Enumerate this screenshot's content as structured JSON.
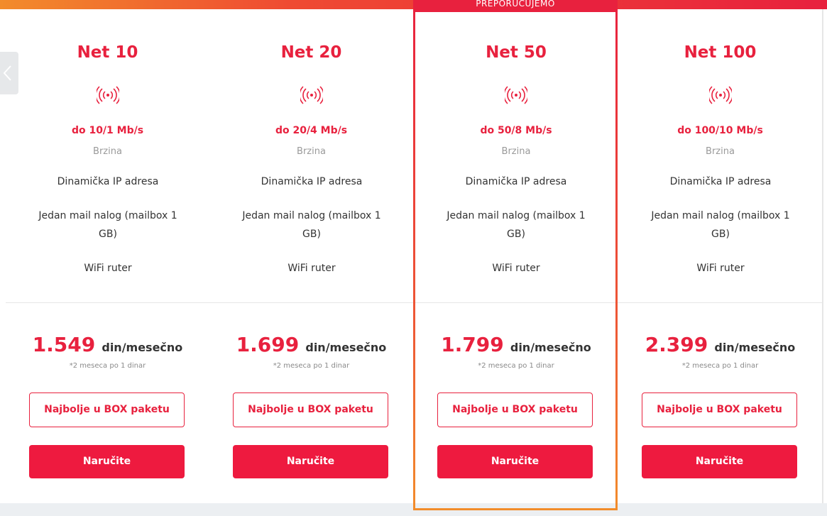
{
  "ribbon": {
    "label": "PREPORUČUJEMO"
  },
  "plans": [
    {
      "name": "Net 10",
      "speed": "do 10/1 Mb/s",
      "speed_label": "Brzina",
      "features": [
        "Dinamička IP adresa",
        "Jedan mail nalog (mailbox 1 GB)",
        "WiFi ruter"
      ],
      "price": "1.549",
      "price_unit": "din/mesečno",
      "promo": "*2 meseca po 1 dinar",
      "box_button": "Najbolje u BOX paketu",
      "order_button": "Naručite"
    },
    {
      "name": "Net 20",
      "speed": "do 20/4 Mb/s",
      "speed_label": "Brzina",
      "features": [
        "Dinamička IP adresa",
        "Jedan mail nalog (mailbox 1 GB)",
        "WiFi ruter"
      ],
      "price": "1.699",
      "price_unit": "din/mesečno",
      "promo": "*2 meseca po 1 dinar",
      "box_button": "Najbolje u BOX paketu",
      "order_button": "Naručite"
    },
    {
      "name": "Net 50",
      "speed": "do 50/8 Mb/s",
      "speed_label": "Brzina",
      "features": [
        "Dinamička IP adresa",
        "Jedan mail nalog (mailbox 1 GB)",
        "WiFi ruter"
      ],
      "price": "1.799",
      "price_unit": "din/mesečno",
      "promo": "*2 meseca po 1 dinar",
      "box_button": "Najbolje u BOX paketu",
      "order_button": "Naručite"
    },
    {
      "name": "Net 100",
      "speed": "do 100/10 Mb/s",
      "speed_label": "Brzina",
      "features": [
        "Dinamička IP adresa",
        "Jedan mail nalog (mailbox 1 GB)",
        "WiFi ruter"
      ],
      "price": "2.399",
      "price_unit": "din/mesečno",
      "promo": "*2 meseca po 1 dinar",
      "box_button": "Najbolje u BOX paketu",
      "order_button": "Naručite"
    }
  ],
  "icons": {
    "speed": "wifi-signal-icon",
    "carousel_prev": "chevron-left-icon"
  },
  "colors": {
    "brand_red": "#e8213e",
    "accent_orange": "#f28c2b",
    "muted_text": "#9a9a9a"
  }
}
